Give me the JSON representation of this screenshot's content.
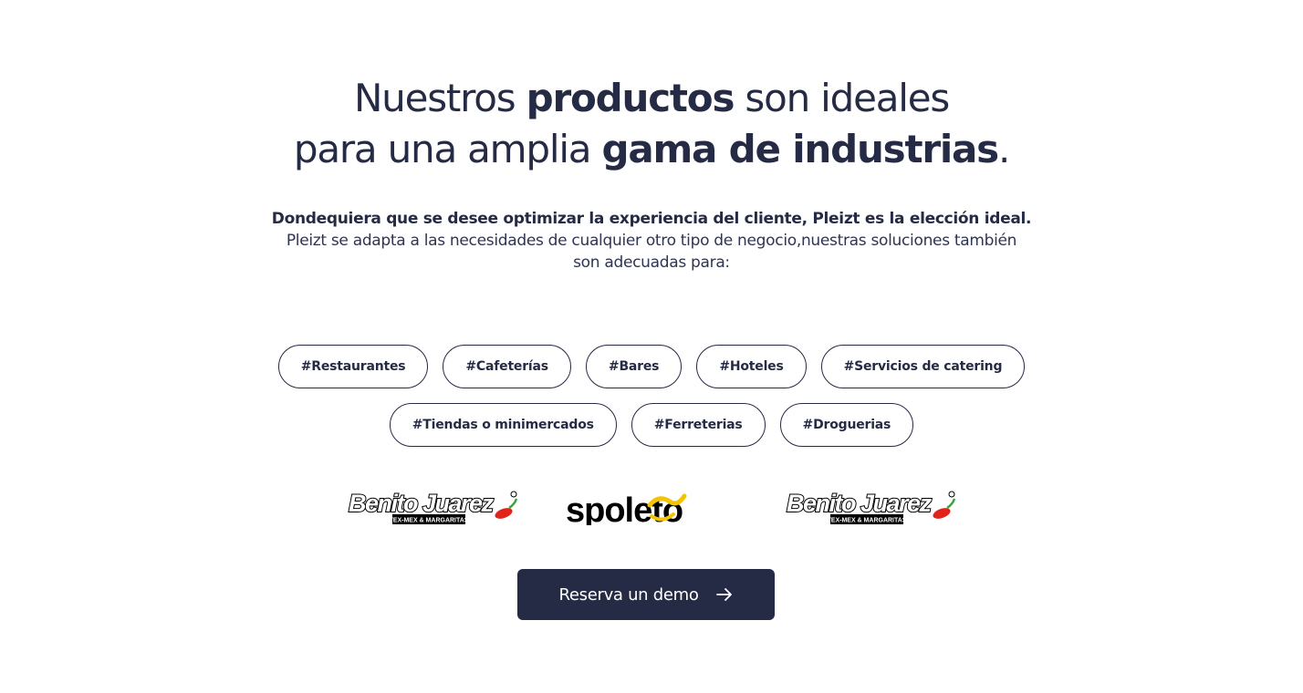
{
  "headline": {
    "line1_pre": "Nuestros ",
    "line1_bold": "productos",
    "line1_post": " son ideales",
    "line2_pre": "para una amplia ",
    "line2_bold": "gama de industrias",
    "line2_post": "."
  },
  "lead": "Dondequiera que se desee optimizar la experiencia del cliente, Pleizt es la elección ideal.",
  "body": "Pleizt se adapta a las necesidades de cualquier otro tipo de negocio,nuestras soluciones también son adecuadas para:",
  "tags_row1": [
    "#Restaurantes",
    "#Cafeterías",
    "#Bares",
    "#Hoteles",
    "#Servicios de catering"
  ],
  "tags_row2": [
    "#Tiendas o minimercados",
    "#Ferreterias",
    "#Droguerias"
  ],
  "logos": [
    {
      "name": "Benito Juarez",
      "tagline": "TEX-MEX & MARGARITAS"
    },
    {
      "name": "spoleto"
    },
    {
      "name": "Benito Juarez",
      "tagline": "TEX-MEX & MARGARITAS"
    }
  ],
  "cta": {
    "label": "Reserva un demo",
    "icon": "arrow-right-icon"
  },
  "colors": {
    "primary": "#262b45",
    "background": "#ffffff",
    "accent_red": "#e2231a",
    "accent_yellow": "#f5c400"
  }
}
